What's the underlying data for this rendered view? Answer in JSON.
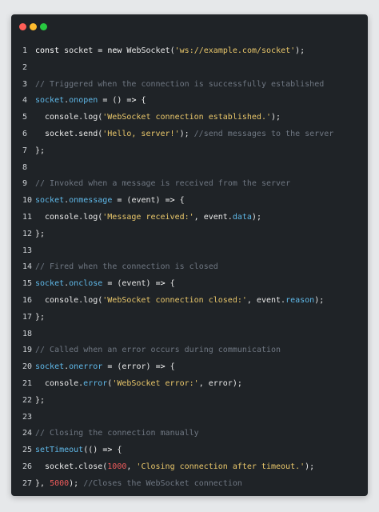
{
  "window": {
    "controls": [
      "close",
      "minimize",
      "maximize"
    ]
  },
  "colors": {
    "background": "#1f2327",
    "string": "#e8c66a",
    "property": "#5fb8e8",
    "comment": "#6f7782",
    "number": "#ee5a5a"
  },
  "code": {
    "language": "javascript",
    "lines": [
      {
        "n": "1",
        "tokens": [
          [
            "kw",
            "const "
          ],
          [
            "punc",
            "socket "
          ],
          [
            "op",
            "= "
          ],
          [
            "kw",
            "new "
          ],
          [
            "punc",
            "WebSocket("
          ],
          [
            "str",
            "'ws://example.com/socket'"
          ],
          [
            "punc",
            ");"
          ]
        ]
      },
      {
        "n": "2",
        "tokens": []
      },
      {
        "n": "3",
        "tokens": [
          [
            "com",
            "// Triggered when the connection is successfully established"
          ]
        ]
      },
      {
        "n": "4",
        "tokens": [
          [
            "prop",
            "socket"
          ],
          [
            "punc",
            "."
          ],
          [
            "prop",
            "onopen"
          ],
          [
            "punc",
            " "
          ],
          [
            "op",
            "= "
          ],
          [
            "punc",
            "() "
          ],
          [
            "op",
            "=> "
          ],
          [
            "punc",
            "{"
          ]
        ]
      },
      {
        "n": "5",
        "indent": true,
        "tokens": [
          [
            "punc",
            "console."
          ],
          [
            "punc",
            "log("
          ],
          [
            "str",
            "'WebSocket connection established.'"
          ],
          [
            "punc",
            ");"
          ]
        ]
      },
      {
        "n": "6",
        "indent": true,
        "tokens": [
          [
            "punc",
            "socket."
          ],
          [
            "punc",
            "send("
          ],
          [
            "str",
            "'Hello, server!'"
          ],
          [
            "punc",
            "); "
          ],
          [
            "com",
            "//send messages to the server"
          ]
        ]
      },
      {
        "n": "7",
        "tokens": [
          [
            "punc",
            "};"
          ]
        ]
      },
      {
        "n": "8",
        "tokens": []
      },
      {
        "n": "9",
        "tokens": [
          [
            "com",
            "// Invoked when a message is received from the server"
          ]
        ]
      },
      {
        "n": "10",
        "tokens": [
          [
            "prop",
            "socket"
          ],
          [
            "punc",
            "."
          ],
          [
            "prop",
            "onmessage"
          ],
          [
            "punc",
            " "
          ],
          [
            "op",
            "= "
          ],
          [
            "punc",
            "(event) "
          ],
          [
            "op",
            "=> "
          ],
          [
            "punc",
            "{"
          ]
        ]
      },
      {
        "n": "11",
        "indent": true,
        "tokens": [
          [
            "punc",
            "console."
          ],
          [
            "punc",
            "log("
          ],
          [
            "str",
            "'Message received:'"
          ],
          [
            "punc",
            ", event."
          ],
          [
            "prop",
            "data"
          ],
          [
            "punc",
            ");"
          ]
        ]
      },
      {
        "n": "12",
        "tokens": [
          [
            "punc",
            "};"
          ]
        ]
      },
      {
        "n": "13",
        "tokens": []
      },
      {
        "n": "14",
        "tokens": [
          [
            "com",
            "// Fired when the connection is closed"
          ]
        ]
      },
      {
        "n": "15",
        "tokens": [
          [
            "prop",
            "socket"
          ],
          [
            "punc",
            "."
          ],
          [
            "prop",
            "onclose"
          ],
          [
            "punc",
            " "
          ],
          [
            "op",
            "= "
          ],
          [
            "punc",
            "(event) "
          ],
          [
            "op",
            "=> "
          ],
          [
            "punc",
            "{"
          ]
        ]
      },
      {
        "n": "16",
        "indent": true,
        "tokens": [
          [
            "punc",
            "console."
          ],
          [
            "punc",
            "log("
          ],
          [
            "str",
            "'WebSocket connection closed:'"
          ],
          [
            "punc",
            ", event."
          ],
          [
            "prop",
            "reason"
          ],
          [
            "punc",
            ");"
          ]
        ]
      },
      {
        "n": "17",
        "tokens": [
          [
            "punc",
            "};"
          ]
        ]
      },
      {
        "n": "18",
        "tokens": []
      },
      {
        "n": "19",
        "tokens": [
          [
            "com",
            "// Called when an error occurs during communication"
          ]
        ]
      },
      {
        "n": "20",
        "tokens": [
          [
            "prop",
            "socket"
          ],
          [
            "punc",
            "."
          ],
          [
            "prop",
            "onerror"
          ],
          [
            "punc",
            " "
          ],
          [
            "op",
            "= "
          ],
          [
            "punc",
            "(error) "
          ],
          [
            "op",
            "=> "
          ],
          [
            "punc",
            "{"
          ]
        ]
      },
      {
        "n": "21",
        "indent": true,
        "tokens": [
          [
            "punc",
            "console."
          ],
          [
            "prop",
            "error"
          ],
          [
            "punc",
            "("
          ],
          [
            "str",
            "'WebSocket error:'"
          ],
          [
            "punc",
            ", error);"
          ]
        ]
      },
      {
        "n": "22",
        "tokens": [
          [
            "punc",
            "};"
          ]
        ]
      },
      {
        "n": "23",
        "tokens": []
      },
      {
        "n": "24",
        "tokens": [
          [
            "com",
            "// Closing the connection manually"
          ]
        ]
      },
      {
        "n": "25",
        "tokens": [
          [
            "prop",
            "setTimeout"
          ],
          [
            "punc",
            "(() "
          ],
          [
            "op",
            "=> "
          ],
          [
            "punc",
            "{"
          ]
        ]
      },
      {
        "n": "26",
        "indent": true,
        "tokens": [
          [
            "punc",
            "socket."
          ],
          [
            "punc",
            "close("
          ],
          [
            "num",
            "1000"
          ],
          [
            "punc",
            ", "
          ],
          [
            "str",
            "'Closing connection after timeout.'"
          ],
          [
            "punc",
            ");"
          ]
        ]
      },
      {
        "n": "27",
        "tokens": [
          [
            "punc",
            "}, "
          ],
          [
            "num",
            "5000"
          ],
          [
            "punc",
            "); "
          ],
          [
            "com",
            "//Closes the WebSocket connection"
          ]
        ]
      }
    ]
  }
}
